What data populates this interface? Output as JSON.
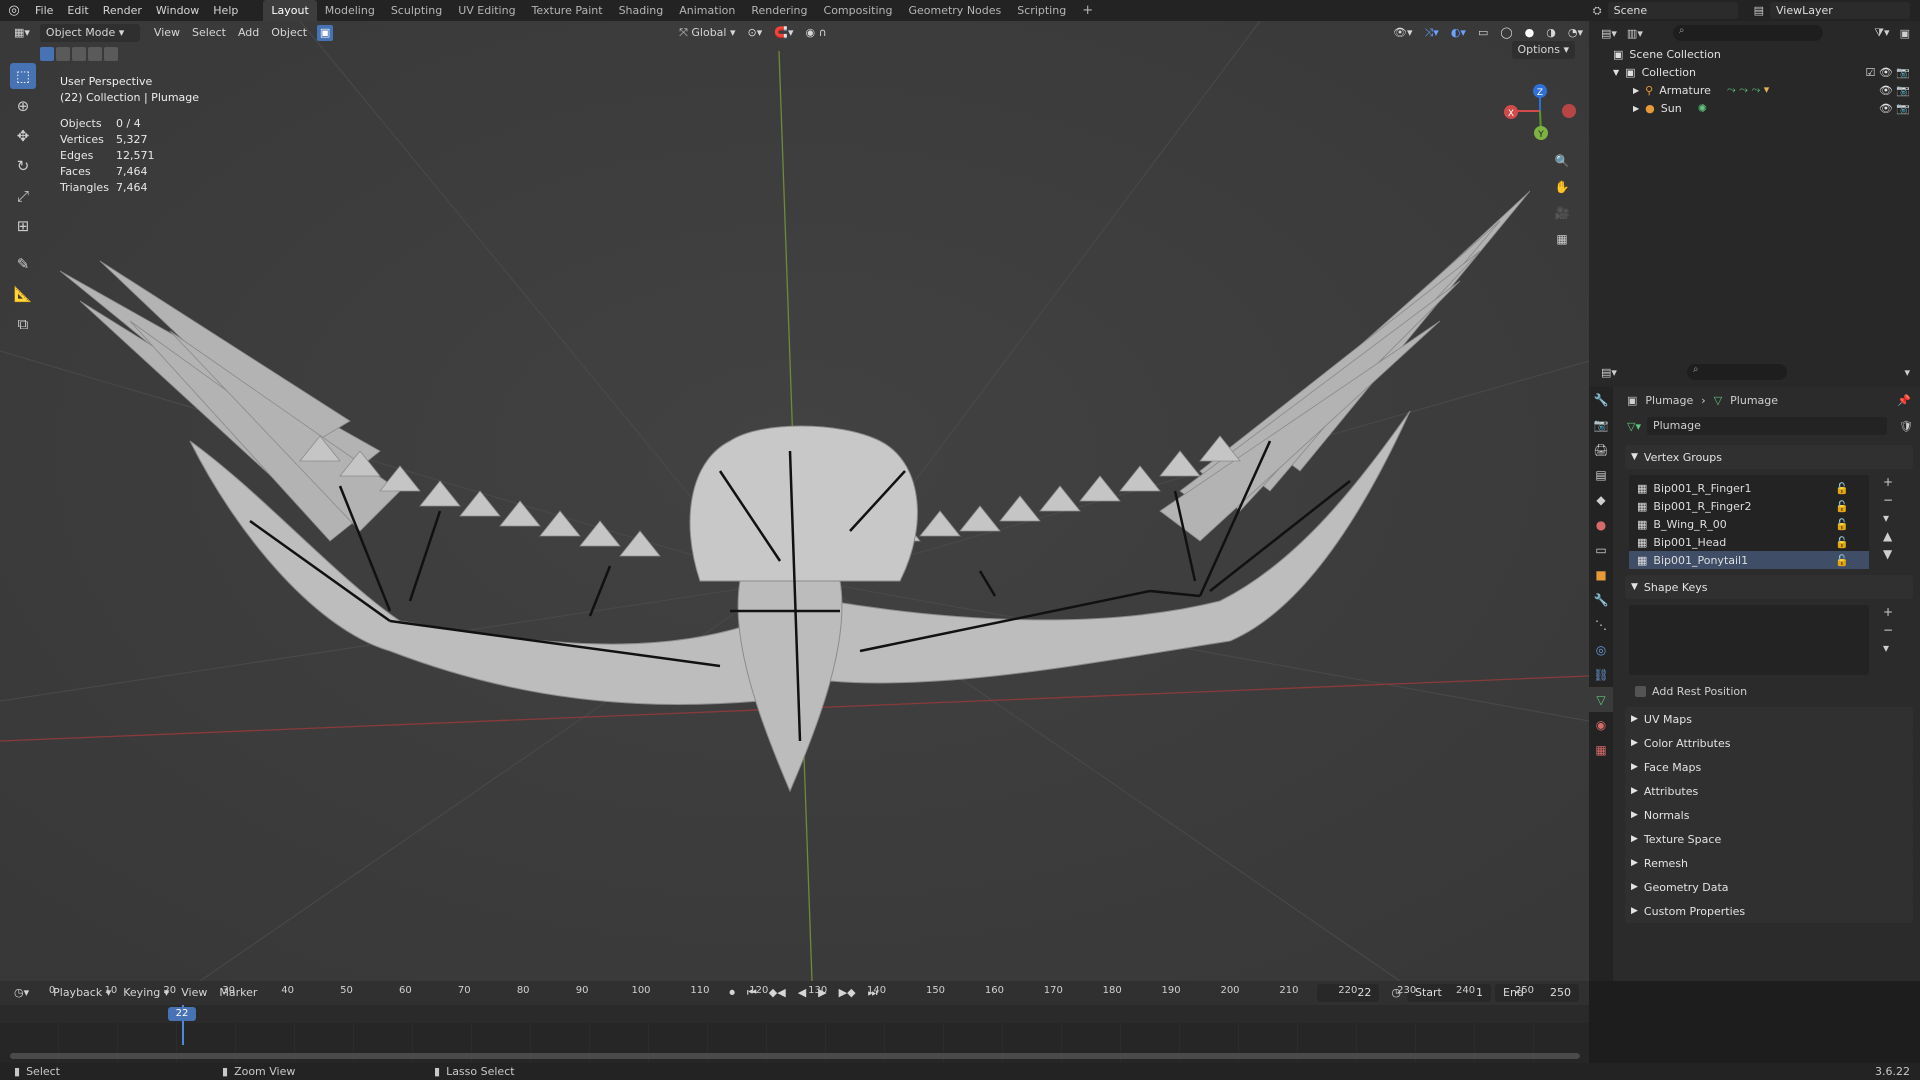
{
  "menus": [
    "File",
    "Edit",
    "Render",
    "Window",
    "Help"
  ],
  "workspaces": [
    "Layout",
    "Modeling",
    "Sculpting",
    "UV Editing",
    "Texture Paint",
    "Shading",
    "Animation",
    "Rendering",
    "Compositing",
    "Geometry Nodes",
    "Scripting"
  ],
  "scene_name": "Scene",
  "view_layer": "ViewLayer",
  "viewport": {
    "mode": "Object Mode",
    "menus": [
      "View",
      "Select",
      "Add",
      "Object"
    ],
    "orientation": "Global",
    "options": "Options",
    "perspective_label": "User Perspective",
    "collection_label": "(22) Collection | Plumage",
    "stats": [
      {
        "label": "Objects",
        "value": "0 / 4"
      },
      {
        "label": "Vertices",
        "value": "5,327"
      },
      {
        "label": "Edges",
        "value": "12,571"
      },
      {
        "label": "Faces",
        "value": "7,464"
      },
      {
        "label": "Triangles",
        "value": "7,464"
      }
    ],
    "gizmo": {
      "x": "X",
      "y": "Y",
      "z": "Z"
    }
  },
  "outliner": {
    "scene_collection": "Scene Collection",
    "collection": "Collection",
    "items": [
      "Armature",
      "Sun"
    ]
  },
  "properties": {
    "breadcrumb_object": "Plumage",
    "breadcrumb_data": "Plumage",
    "mesh_name": "Plumage",
    "vertex_groups_title": "Vertex Groups",
    "vertex_groups": [
      "Bip001_R_Finger1",
      "Bip001_R_Finger2",
      "B_Wing_R_00",
      "Bip001_Head",
      "Bip001_Ponytail1"
    ],
    "shape_keys_title": "Shape Keys",
    "add_rest_position": "Add Rest Position",
    "collapsed_panels": [
      "UV Maps",
      "Color Attributes",
      "Face Maps",
      "Attributes",
      "Normals",
      "Texture Space",
      "Remesh",
      "Geometry Data",
      "Custom Properties"
    ]
  },
  "timeline": {
    "menus": [
      "Playback",
      "Keying",
      "View",
      "Marker"
    ],
    "current_frame": "22",
    "start_label": "Start",
    "start": "1",
    "end_label": "End",
    "end": "250",
    "ticks": [
      "0",
      "10",
      "20",
      "30",
      "40",
      "50",
      "60",
      "70",
      "80",
      "90",
      "100",
      "110",
      "120",
      "130",
      "140",
      "150",
      "160",
      "170",
      "180",
      "190",
      "200",
      "210",
      "220",
      "230",
      "240",
      "250"
    ]
  },
  "statusbar": {
    "select": "Select",
    "zoom": "Zoom View",
    "lasso": "Lasso Select",
    "version": "3.6.22"
  }
}
